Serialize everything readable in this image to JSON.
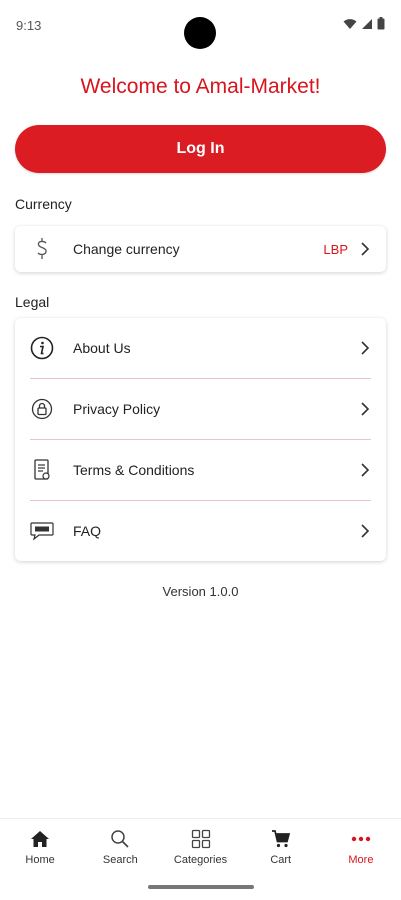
{
  "status_bar": {
    "time": "9:13"
  },
  "header": {
    "welcome": "Welcome to Amal-Market!"
  },
  "login": {
    "label": "Log In"
  },
  "currency_section": {
    "title": "Currency",
    "items": [
      {
        "label": "Change currency",
        "value": "LBP",
        "icon": "dollar-icon"
      }
    ]
  },
  "legal_section": {
    "title": "Legal",
    "items": [
      {
        "label": "About Us",
        "icon": "info-icon"
      },
      {
        "label": "Privacy Policy",
        "icon": "lock-icon"
      },
      {
        "label": "Terms & Conditions",
        "icon": "document-icon"
      },
      {
        "label": "FAQ",
        "icon": "faq-icon"
      }
    ]
  },
  "footer": {
    "version": "Version 1.0.0"
  },
  "bottom_nav": {
    "items": [
      {
        "label": "Home",
        "icon": "home-icon"
      },
      {
        "label": "Search",
        "icon": "search-icon"
      },
      {
        "label": "Categories",
        "icon": "grid-icon"
      },
      {
        "label": "Cart",
        "icon": "cart-icon"
      },
      {
        "label": "More",
        "icon": "more-dots-icon",
        "active": true
      }
    ]
  },
  "colors": {
    "accent": "#dc1c23",
    "accent_text": "#d9141e",
    "divider": "#e8c6c8"
  }
}
